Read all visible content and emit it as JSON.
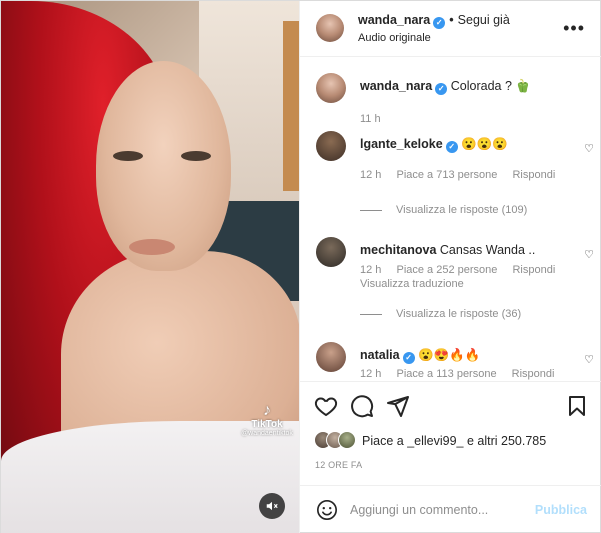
{
  "post": {
    "author": "wanda_nara",
    "follow_status": "Segui già",
    "audio_label": "Audio originale",
    "more_label": "•••"
  },
  "media": {
    "watermark_brand": "TikTok",
    "watermark_handle": "@wandaentiktok"
  },
  "caption": {
    "username": "wanda_nara",
    "text": "Colorada ? 🫑",
    "time": "11 h"
  },
  "comments": [
    {
      "username": "lgante_keloke",
      "verified": true,
      "text": "😮😮😮",
      "time": "12 h",
      "likes": "Piace a 713 persone",
      "reply": "Rispondi",
      "view_replies": "Visualizza le risposte (109)"
    },
    {
      "username": "mechitanova",
      "verified": false,
      "text": "Cansas Wanda ..",
      "time": "12 h",
      "likes": "Piace a 252 persone",
      "reply": "Rispondi",
      "translate": "Visualizza traduzione",
      "view_replies": "Visualizza le risposte (36)"
    },
    {
      "username": "natalia",
      "verified": true,
      "text": "😮😍🔥🔥",
      "time": "12 h",
      "likes": "Piace a 113 persone",
      "reply": "Rispondi"
    }
  ],
  "likes_summary": {
    "prefix": "Piace a",
    "user": "_ellevi99_",
    "suffix": "e altri 250.785"
  },
  "timestamp": "12 ORE FA",
  "add_comment": {
    "placeholder": "Aggiungi un commento...",
    "post_label": "Pubblica"
  },
  "colors": {
    "verified": "#3897f0",
    "post_button_disabled": "#b2dffc",
    "secondary_text": "#8e8e8e"
  }
}
